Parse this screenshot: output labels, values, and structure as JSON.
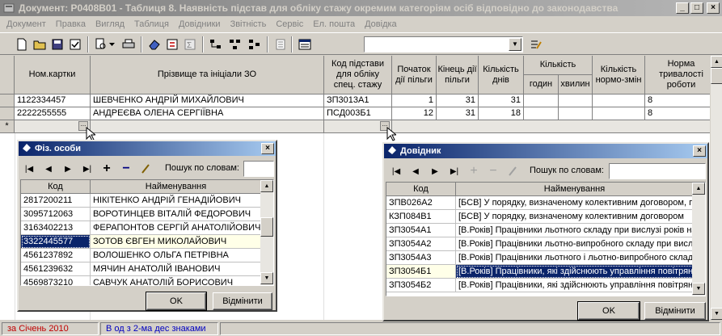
{
  "window": {
    "title": "Документ: Р0408В01 - Таблиця 8. Наявність підстав для обліку стажу окремим категоріям осіб відповідно до законодавства"
  },
  "menu": [
    "Документ",
    "Правка",
    "Вигляд",
    "Таблиця",
    "Довідники",
    "Звітність",
    "Сервіс",
    "Ел. пошта",
    "Довідка"
  ],
  "grid": {
    "headers": {
      "card": "Ном.картки",
      "name": "Прізвище та ініціали ЗО",
      "code": "Код підстави для обліку спец. стажу",
      "start": "Початок дії пільги",
      "end": "Кінець дії пільги",
      "days": "Кількість днів",
      "qty": "Кількість",
      "hours": "годин",
      "minutes": "хвилин",
      "shifts": "Кількість нормо-змін",
      "norm": "Норма тривалості роботи"
    },
    "rows": [
      {
        "card": "1122334457",
        "name": "ШЕВЧЕНКО АНДРІЙ МИХАЙЛОВИЧ",
        "code": "ЗП3013А1",
        "start": "1",
        "end": "31",
        "days": "31",
        "hours": "",
        "minutes": "",
        "shifts": "",
        "norm": "8"
      },
      {
        "card": "2222255555",
        "name": "АНДРЕЄВА ОЛЕНА СЕРГІЇВНА",
        "code": "ПСД003Б1",
        "start": "12",
        "end": "31",
        "days": "18",
        "hours": "",
        "minutes": "",
        "shifts": "",
        "norm": "8"
      }
    ],
    "new_row_marker": "*",
    "ellipsis": "..."
  },
  "status": {
    "period": "за Січень 2010",
    "mode": "В од з 2-ма дес знаками"
  },
  "fiz_dialog": {
    "title": "Фіз. особи",
    "search_label": "Пошук по словам:",
    "col_code": "Код",
    "col_name": "Найменування",
    "rows": [
      {
        "code": "2817200211",
        "name": "НІКІТЕНКО АНДРІЙ ГЕНАДІЙОВИЧ"
      },
      {
        "code": "3095712063",
        "name": "ВОРОТИНЦЕВ ВІТАЛІЙ ФЕДОРОВИЧ"
      },
      {
        "code": "3163402213",
        "name": "ФЕРАПОНТОВ СЕРГІЙ АНАТОЛІЙОВИЧ"
      },
      {
        "code": "3322445577",
        "name": "ЗОТОВ ЄВГЕН МИКОЛАЙОВИЧ"
      },
      {
        "code": "4561237892",
        "name": "ВОЛОШЕНКО ОЛЬГА ПЕТРІВНА"
      },
      {
        "code": "4561239632",
        "name": "МЯЧИН АНАТОЛІЙ ІВАНОВИЧ"
      },
      {
        "code": "4569873210",
        "name": "САВЧУК АНАТОЛІЙ БОРИСОВИЧ"
      }
    ],
    "ok": "OK",
    "cancel": "Відмінити"
  },
  "dov_dialog": {
    "title": "Довідник",
    "search_label": "Пошук по словам:",
    "col_code": "Код",
    "col_name": "Найменування",
    "rows": [
      {
        "code": "ЗПВ026А2",
        "name": "[БСВ]   У порядку, визначеному колективним договором, п"
      },
      {
        "code": "КЗП084В1",
        "name": "[БСВ]   У порядку, визначеному колективним договором"
      },
      {
        "code": "ЗП3054А1",
        "name": "[В.Років] Працівники льотного складу при вислузі років на"
      },
      {
        "code": "ЗП3054А2",
        "name": "[В.Років] Працівники льотно-випробного складу при вислу"
      },
      {
        "code": "ЗП3054А3",
        "name": "[В.Років] Працівники льотного і льотно-випробного складу"
      },
      {
        "code": "ЗП3054Б1",
        "name": "[В.Років] Працівники, які здійснюють управління повітряни"
      },
      {
        "code": "ЗП3054Б2",
        "name": "[В.Років] Працівники, які здійснюють управління повітрян"
      }
    ],
    "ok": "OK",
    "cancel": "Відмінити"
  }
}
